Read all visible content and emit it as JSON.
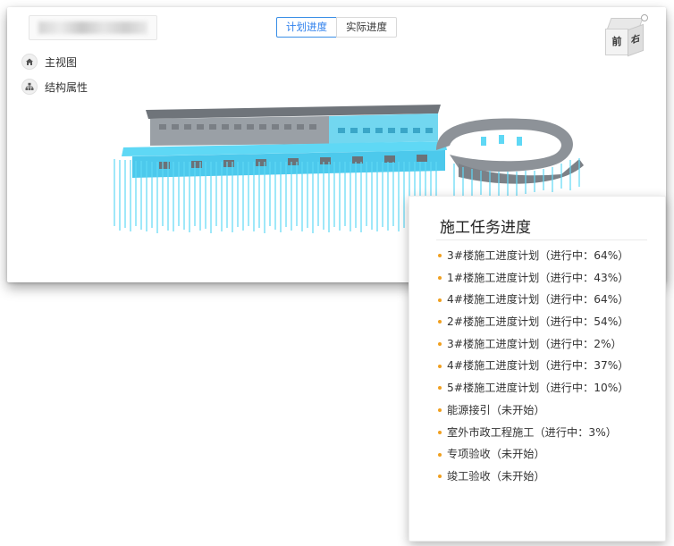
{
  "header": {
    "project_title": "██████████",
    "tabs": [
      {
        "label": "计划进度",
        "active": true
      },
      {
        "label": "实际进度",
        "active": false
      }
    ]
  },
  "navcube": {
    "front": "前",
    "right": "右"
  },
  "sidenav": {
    "items": [
      {
        "label": "主视图",
        "icon": "home-icon"
      },
      {
        "label": "结构属性",
        "icon": "structure-icon"
      }
    ]
  },
  "task_panel": {
    "title": "施工任务进度",
    "tasks": [
      "3#楼施工进度计划（进行中：64%）",
      "1#楼施工进度计划（进行中：43%）",
      "4#楼施工进度计划（进行中：64%）",
      "2#楼施工进度计划（进行中：54%）",
      "3#楼施工进度计划（进行中：2%）",
      "4#楼施工进度计划（进行中：37%）",
      "5#楼施工进度计划（进行中：10%）",
      "能源接引（未开始）",
      "室外市政工程施工（进行中：3%）",
      "专项验收（未开始）",
      "竣工验收（未开始）"
    ],
    "bullet_color": "#f0a020"
  },
  "colors": {
    "accent": "#2f80ed",
    "model_cyan": "#5fd8f5",
    "model_grey": "#8a8f96"
  }
}
